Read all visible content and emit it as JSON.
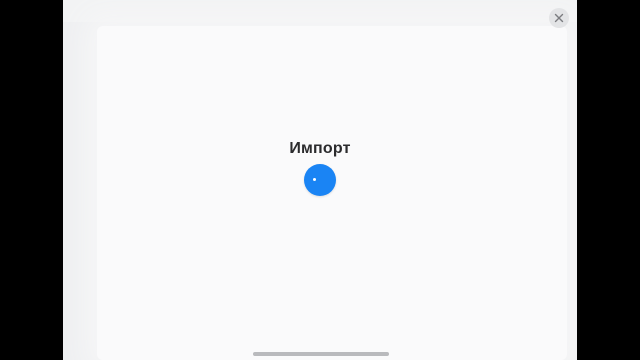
{
  "dialog": {
    "title": "Импорт"
  },
  "icons": {
    "close": "close-icon",
    "spinner": "activity-spinner-icon"
  },
  "colors": {
    "accent": "#1a84f4",
    "background": "#fafafb",
    "title": "#2b2b2d"
  }
}
